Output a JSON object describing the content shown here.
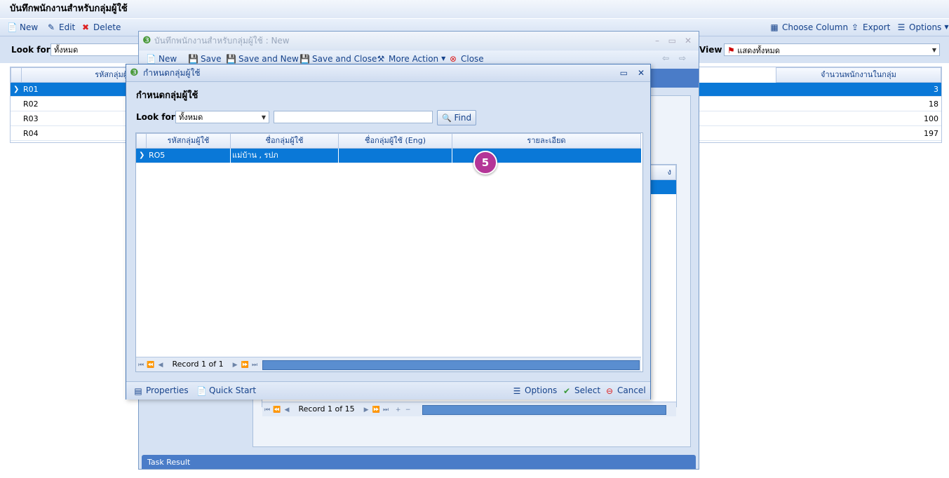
{
  "page": {
    "title": "บันทึกพนักงานสำหรับกลุ่มผู้ใช้"
  },
  "toolbar": {
    "new": "New",
    "edit": "Edit",
    "delete": "Delete",
    "choose_column": "Choose Column",
    "export": "Export",
    "options": "Options"
  },
  "filter": {
    "look_for_label": "Look for",
    "look_for_value": "ทั้งหมด",
    "view_label": "View",
    "view_value": "แสดงทั้งหมด"
  },
  "main_grid": {
    "col_code": "รหัสกลุ่มผู้ใช้",
    "col_count": "จำนวนพนักงานในกลุ่ม",
    "rows": [
      {
        "code": "R01",
        "count": "3"
      },
      {
        "code": "R02",
        "count": "18"
      },
      {
        "code": "R03",
        "count": "100"
      },
      {
        "code": "R04",
        "count": "197"
      }
    ]
  },
  "back_dialog": {
    "title": "บันทึกพนักงานสำหรับกลุ่มผู้ใช้ : New",
    "toolbar": {
      "new": "New",
      "save": "Save",
      "save_new": "Save and New",
      "save_close": "Save and Close",
      "more_action": "More Action",
      "close": "Close"
    },
    "inner_col_header": "ง",
    "pager_text": "Record 1 of 15",
    "task_result": "Task Result"
  },
  "front_dialog": {
    "title": "กำหนดกลุ่มผู้ใช้",
    "heading": "กำหนดกลุ่มผู้ใช้",
    "look_for_label": "Look for",
    "look_for_value": "ทั้งหมด",
    "search_value": "",
    "find": "Find",
    "columns": [
      "รหัสกลุ่มผู้ใช้",
      "ชื่อกลุ่มผู้ใช้",
      "ชื่อกลุ่มผู้ใช้ (Eng)",
      "รายละเอียด"
    ],
    "rows": [
      {
        "code": "RO5",
        "name": "แม่บ้าน , รปภ",
        "name_eng": "",
        "detail": ""
      }
    ],
    "badge": "5",
    "pager_text": "Record 1 of 1",
    "footer": {
      "properties": "Properties",
      "quick_start": "Quick Start",
      "options": "Options",
      "select": "Select",
      "cancel": "Cancel"
    }
  },
  "colors": {
    "selected_row": "#0a78d7",
    "badge": "#b43597",
    "accent": "#15428b"
  }
}
